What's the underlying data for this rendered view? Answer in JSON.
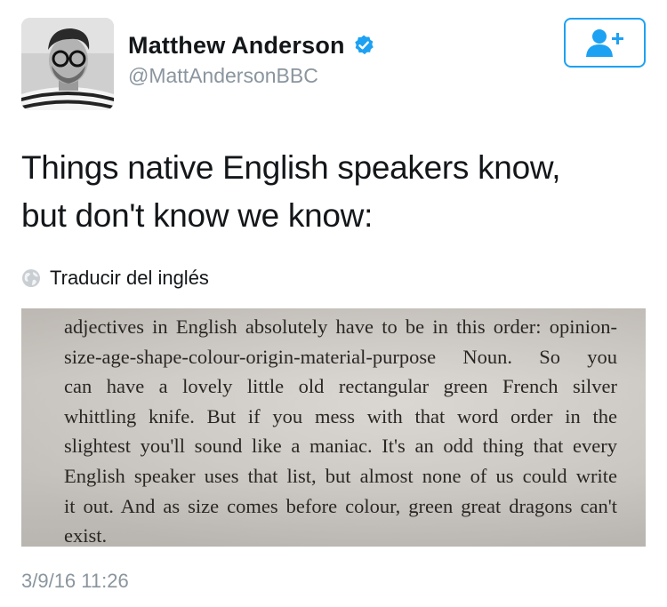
{
  "tweet": {
    "author": {
      "display_name": "Matthew Anderson",
      "handle": "@MattAndersonBBC",
      "verified": true,
      "avatar": "profile-photo-icon",
      "verified_icon": "verified-badge-icon"
    },
    "follow_button": {
      "icon": "add-user-icon",
      "accent_color": "#1da1f2"
    },
    "text": "Things native English speakers know,\nbut don't know we know:",
    "translate": {
      "icon": "globe-icon",
      "label": "Traducir del inglés"
    },
    "media": {
      "type": "photo-of-book-page",
      "lines": [
        "adjectives in English absolutely have to be in this order: opinion-",
        "size-age-shape-colour-origin-material-purpose Noun. So you",
        "can have a lovely little old rectangular green French silver",
        "whittling knife. But if you mess with that word order in the",
        "slightest you'll sound like a maniac. It's an odd thing that every",
        "English speaker uses that list, but almost none of us could write",
        "it out. And as size comes before colour, green great dragons can't",
        "exist."
      ]
    },
    "timestamp": "3/9/16 11:26"
  },
  "colors": {
    "text_primary": "#14171a",
    "text_secondary": "#8a959e",
    "accent": "#1da1f2"
  }
}
